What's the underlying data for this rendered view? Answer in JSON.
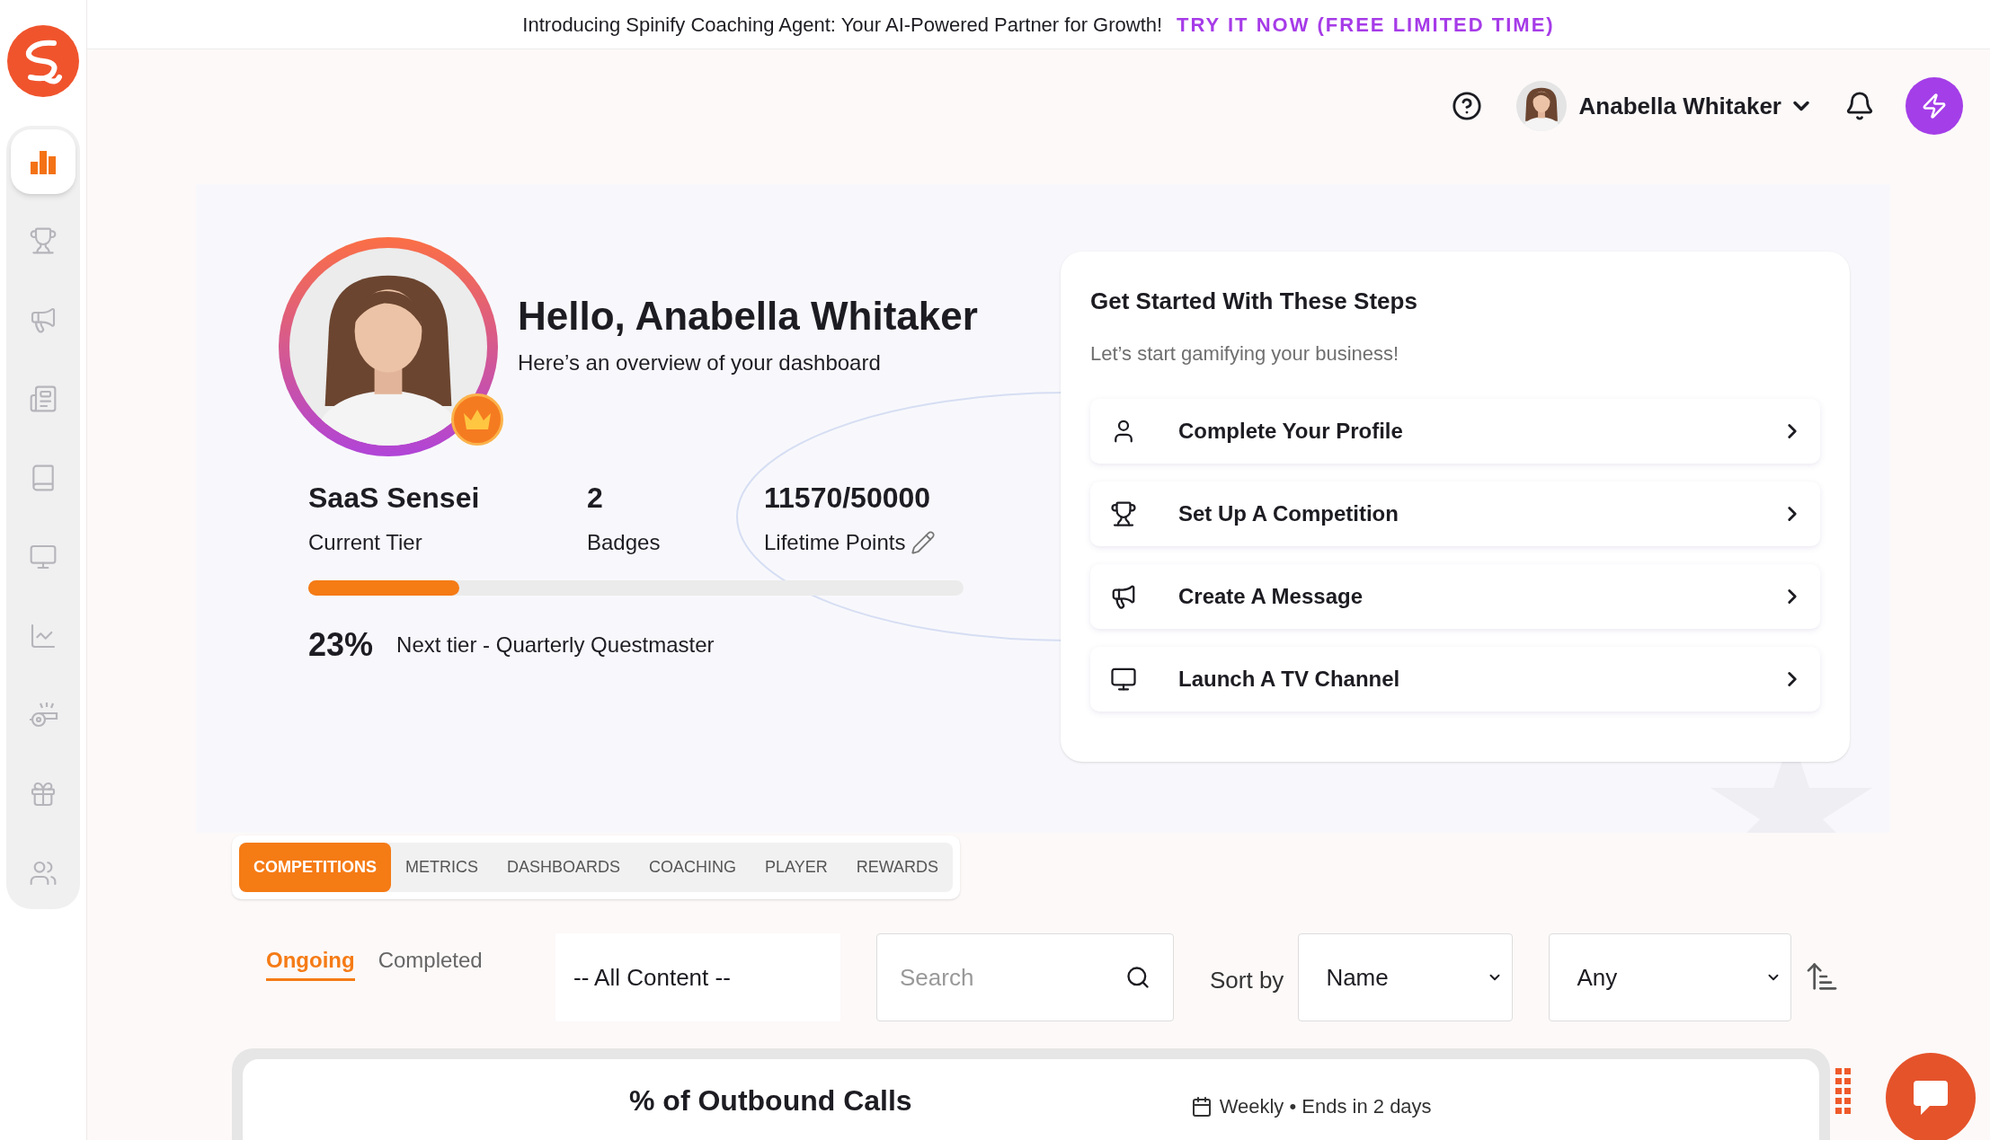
{
  "banner": {
    "text": "Introducing Spinify Coaching Agent: Your AI-Powered Partner for Growth!",
    "link": "TRY IT NOW (FREE LIMITED TIME)"
  },
  "sidebar": {
    "items": [
      {
        "selected": true
      },
      {
        "selected": false
      },
      {
        "selected": false
      },
      {
        "selected": false
      },
      {
        "selected": false
      },
      {
        "selected": false
      },
      {
        "selected": false
      },
      {
        "selected": false
      },
      {
        "selected": false
      },
      {
        "selected": false
      }
    ]
  },
  "header": {
    "user_name": "Anabella Whitaker"
  },
  "hero": {
    "greeting": "Hello, Anabella Whitaker",
    "subtitle": "Here’s an overview of your dashboard",
    "stats": [
      {
        "value": "SaaS Sensei",
        "label": "Current Tier"
      },
      {
        "value": "2",
        "label": "Badges"
      },
      {
        "value": "11570/50000",
        "label": "Lifetime Points"
      }
    ],
    "progress": {
      "level": 0.23,
      "percent": "23%",
      "next_tier": "Next tier - Quarterly Questmaster"
    }
  },
  "steps_card": {
    "title": "Get Started With These Steps",
    "subtitle": "Let’s start gamifying your business!",
    "steps": [
      {
        "label": "Complete Your Profile"
      },
      {
        "label": "Set Up A Competition"
      },
      {
        "label": "Create A Message"
      },
      {
        "label": "Launch A TV Channel"
      }
    ]
  },
  "tabs": [
    {
      "label": "COMPETITIONS",
      "selected": true
    },
    {
      "label": "METRICS",
      "selected": false
    },
    {
      "label": "DASHBOARDS",
      "selected": false
    },
    {
      "label": "COACHING",
      "selected": false
    },
    {
      "label": "PLAYER",
      "selected": false
    },
    {
      "label": "REWARDS",
      "selected": false
    }
  ],
  "status_tabs": [
    {
      "label": "Ongoing",
      "selected": true
    },
    {
      "label": "Completed",
      "selected": false
    }
  ],
  "filters": {
    "content": "-- All Content --",
    "search_placeholder": "Search",
    "sort_label": "Sort by",
    "sort": "Name",
    "period": "Any"
  },
  "competition_card": {
    "title": "% of Outbound Calls",
    "schedule": "Weekly • Ends in 2 days"
  }
}
